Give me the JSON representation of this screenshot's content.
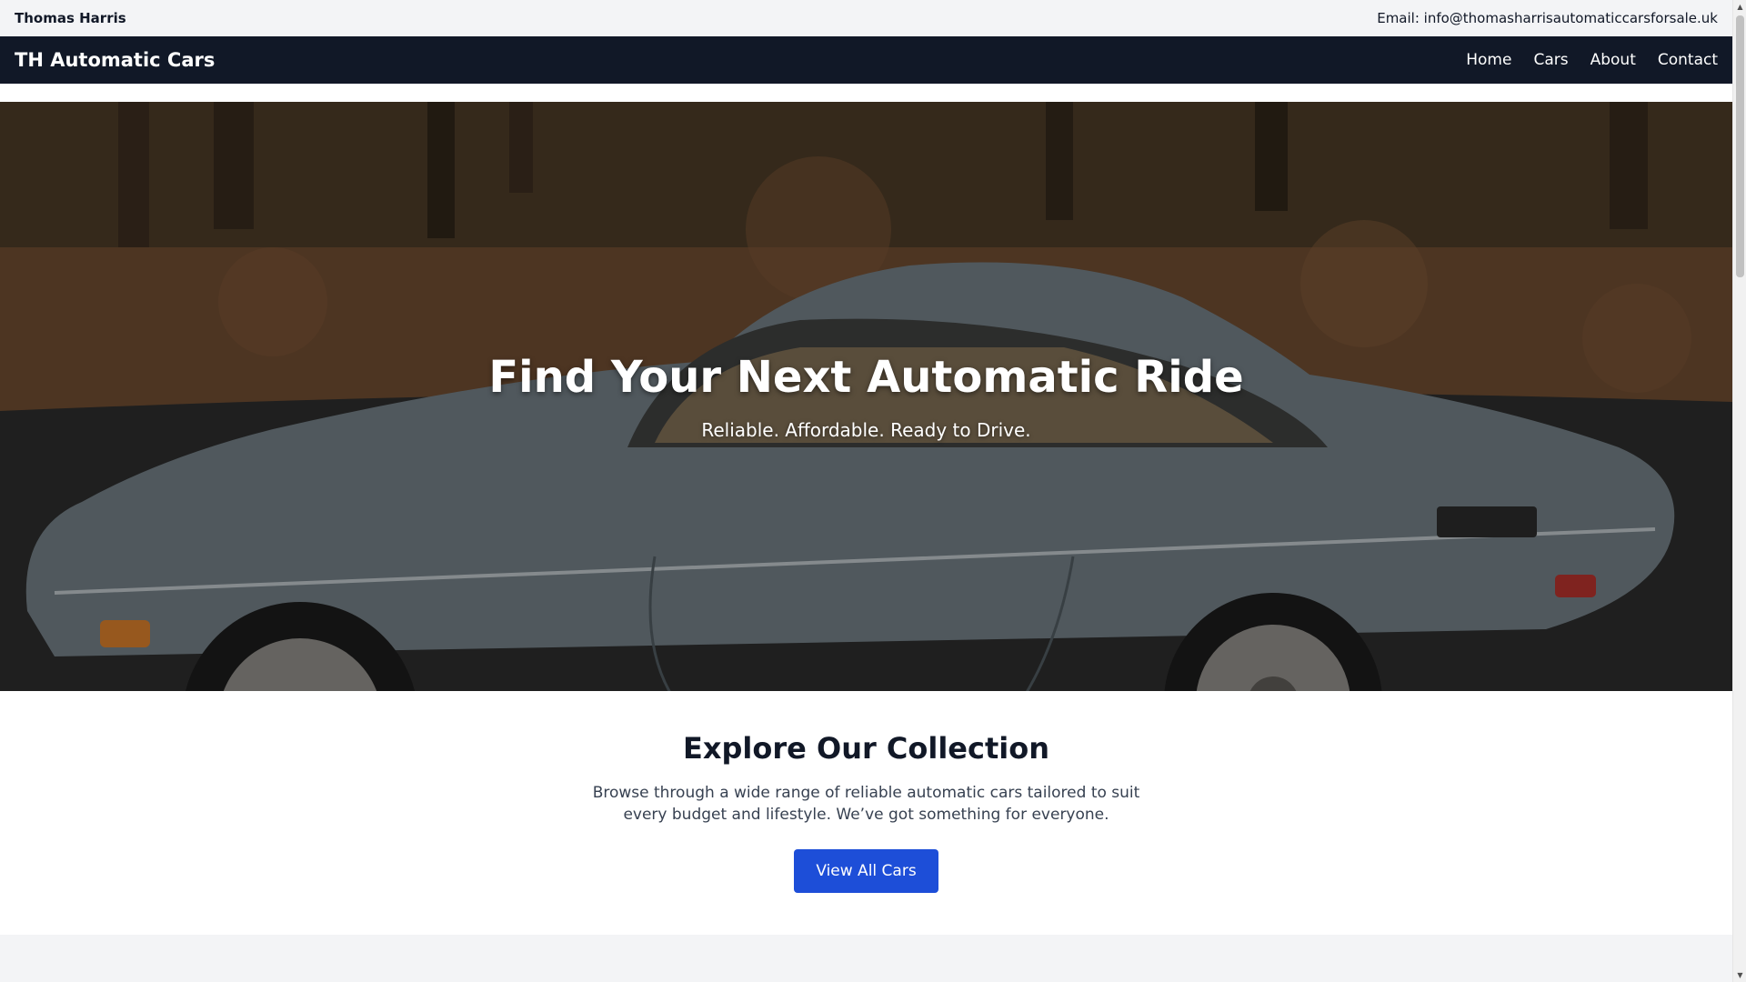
{
  "topbar": {
    "owner": "Thomas Harris",
    "email": "Email: info@thomasharrisautomaticcarsforsale.uk"
  },
  "navbar": {
    "brand": "TH Automatic Cars",
    "links": [
      "Home",
      "Cars",
      "About",
      "Contact"
    ]
  },
  "hero": {
    "title": "Find Your Next Automatic Ride",
    "subtitle": "Reliable. Affordable. Ready to Drive.",
    "image": "vintage-grey-coupe-photo"
  },
  "collection": {
    "heading": "Explore Our Collection",
    "description": "Browse through a wide range of reliable automatic cars tailored to suit every budget and lifestyle. We’ve got something for everyone.",
    "button_label": "View All Cars"
  },
  "scrollbar": {
    "up_icon": "▲",
    "down_icon": "▼"
  },
  "colors": {
    "nav_background": "#111827",
    "accent": "#1d4ed8",
    "topbar_background": "#f3f4f6"
  }
}
